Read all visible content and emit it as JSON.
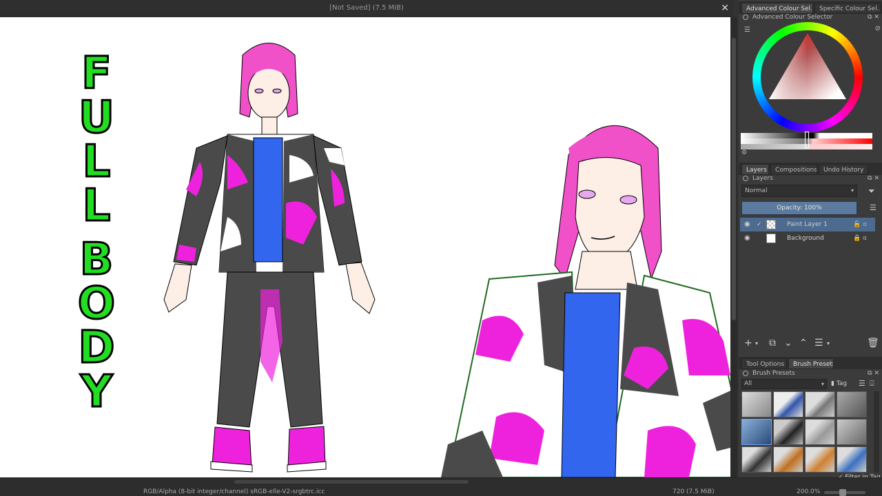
{
  "document": {
    "title": "[Not Saved]  (7.5 MiB)",
    "close": "✕"
  },
  "canvas_text": {
    "line1": [
      "F",
      "U",
      "L",
      "L"
    ],
    "line2": [
      "B",
      "O",
      "D",
      "Y"
    ]
  },
  "dock": {
    "top_tabs": [
      "Advanced Colour Sel...",
      "Specific Colour Sel..."
    ],
    "colour_panel_title": "Advanced Colour Selector",
    "layer_tabs": [
      "Layers",
      "Compositions",
      "Undo History"
    ],
    "layers_panel_title": "Layers",
    "blend_mode": "Normal",
    "opacity": "Opacity:  100%",
    "layers": [
      {
        "name": "Paint Layer 1",
        "selected": true
      },
      {
        "name": "Background",
        "selected": false
      }
    ],
    "bottom_tabs": [
      "Tool Options",
      "Brush Presets"
    ],
    "brush_panel_title": "Brush Presets",
    "brush_filter": "All",
    "tag_label": "Tag",
    "filter_in_tag": "Filter in Tag"
  },
  "status": {
    "color_info": "RGB/Alpha (8-bit integer/channel)  sRGB-elle-V2-srgbtrc.icc",
    "size_info": "720 (7.5 MiB)",
    "zoom": "200.0%"
  },
  "colors": {
    "canvas_bg": "#ffffff",
    "text_green": "#22dd22",
    "hair_pink": "#f050c8",
    "jacket_magenta": "#ee22dd",
    "jacket_dark": "#4a4a4a",
    "shirt_blue": "#3366ee",
    "selection_blue": "#4d6b8f"
  }
}
